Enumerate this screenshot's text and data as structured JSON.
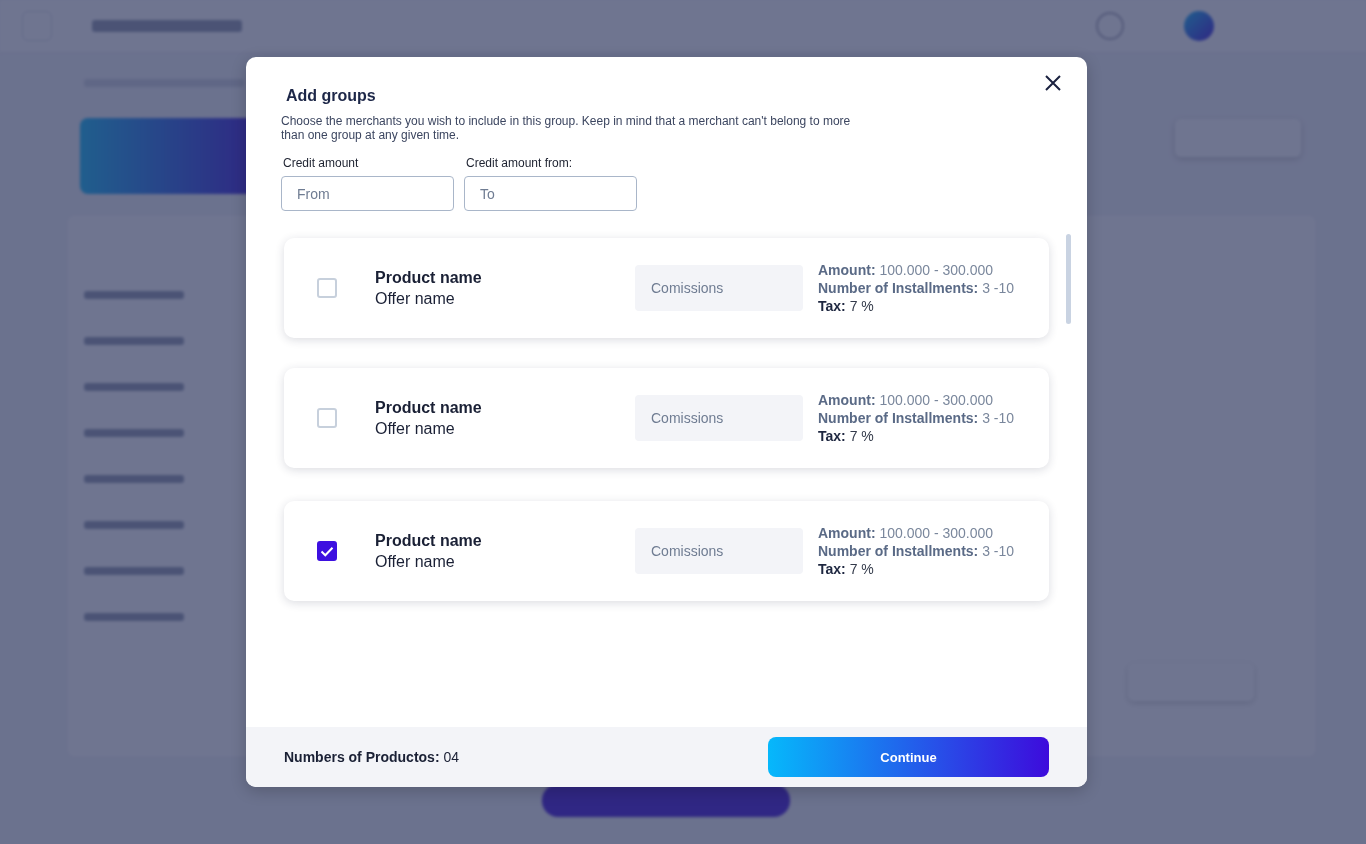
{
  "modal": {
    "title": "Add groups",
    "description": "Choose the merchants you wish to include in this group. Keep in mind that a merchant can't belong to more than one group at any given time.",
    "filters": [
      {
        "label": "Credit amount",
        "placeholder": "From"
      },
      {
        "label": "Credit amount from:",
        "placeholder": "To"
      }
    ],
    "products": [
      {
        "name": "Product name",
        "offer": "Offer name",
        "checked": false,
        "commissions": {
          "placeholder": "Comissions"
        },
        "details": [
          {
            "text": "**Amount:** 100.000 - 300.000",
            "dark": false
          },
          {
            "text": "**Number of Installments:** 3 -10",
            "dark": false
          },
          {
            "text": "**Tax:** 7 %",
            "dark": true
          }
        ]
      },
      {
        "name": "Product name",
        "offer": "Offer name",
        "checked": false,
        "commissions": {
          "placeholder": "Comissions"
        },
        "details": [
          {
            "text": "**Amount:** 100.000 - 300.000",
            "dark": false
          },
          {
            "text": "**Number of Installments:** 3 -10",
            "dark": false
          },
          {
            "text": "**Tax:** 7 %",
            "dark": true
          }
        ]
      },
      {
        "name": "Product name",
        "offer": "Offer name",
        "checked": true,
        "commissions": {
          "placeholder": "Comissions"
        },
        "details": [
          {
            "text": "**Amount:** 100.000 - 300.000",
            "dark": false
          },
          {
            "text": "**Number of Installments:** 3 -10",
            "dark": false
          },
          {
            "text": "**Tax:** 7 %",
            "dark": true
          }
        ]
      }
    ],
    "footer": {
      "count": "**Numbers of Productos:** 04",
      "continue_button": "Continue"
    }
  }
}
